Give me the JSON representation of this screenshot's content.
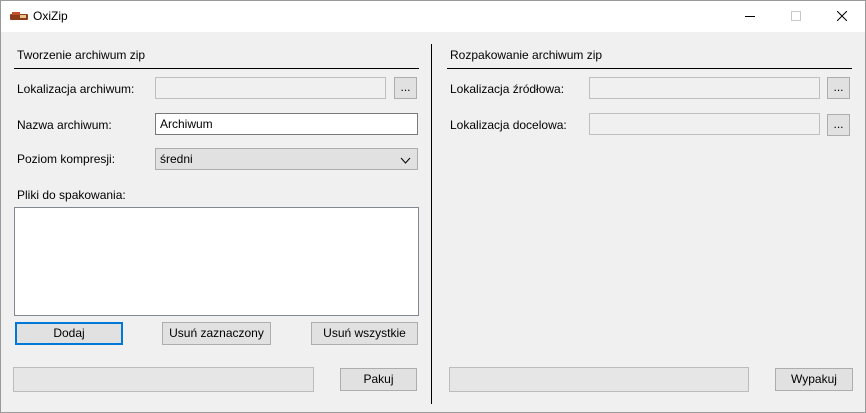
{
  "window": {
    "title": "OxiZip",
    "controls": {
      "minimize_icon": "minimize-icon",
      "maximize_icon": "maximize-icon",
      "close_icon": "close-icon"
    }
  },
  "create": {
    "section_title": "Tworzenie archiwum zip",
    "location_label": "Lokalizacja archiwum:",
    "location_value": "",
    "browse_label": "...",
    "name_label": "Nazwa archiwum:",
    "name_value": "Archiwum",
    "compression_label": "Poziom kompresji:",
    "compression_value": "średni",
    "files_label": "Pliki do spakowania:",
    "files": [],
    "add_button": "Dodaj",
    "remove_selected_button": "Usuń zaznaczony",
    "remove_all_button": "Usuń wszystkie",
    "pack_button": "Pakuj",
    "progress": 0
  },
  "extract": {
    "section_title": "Rozpakowanie archiwum zip",
    "source_label": "Lokalizacja źródłowa:",
    "source_value": "",
    "dest_label": "Lokalizacja docelowa:",
    "dest_value": "",
    "browse_label": "...",
    "unpack_button": "Wypakuj",
    "progress": 0
  },
  "colors": {
    "accent": "#0078d7",
    "background": "#f0f0f0",
    "progress_fill": "#06b025"
  }
}
